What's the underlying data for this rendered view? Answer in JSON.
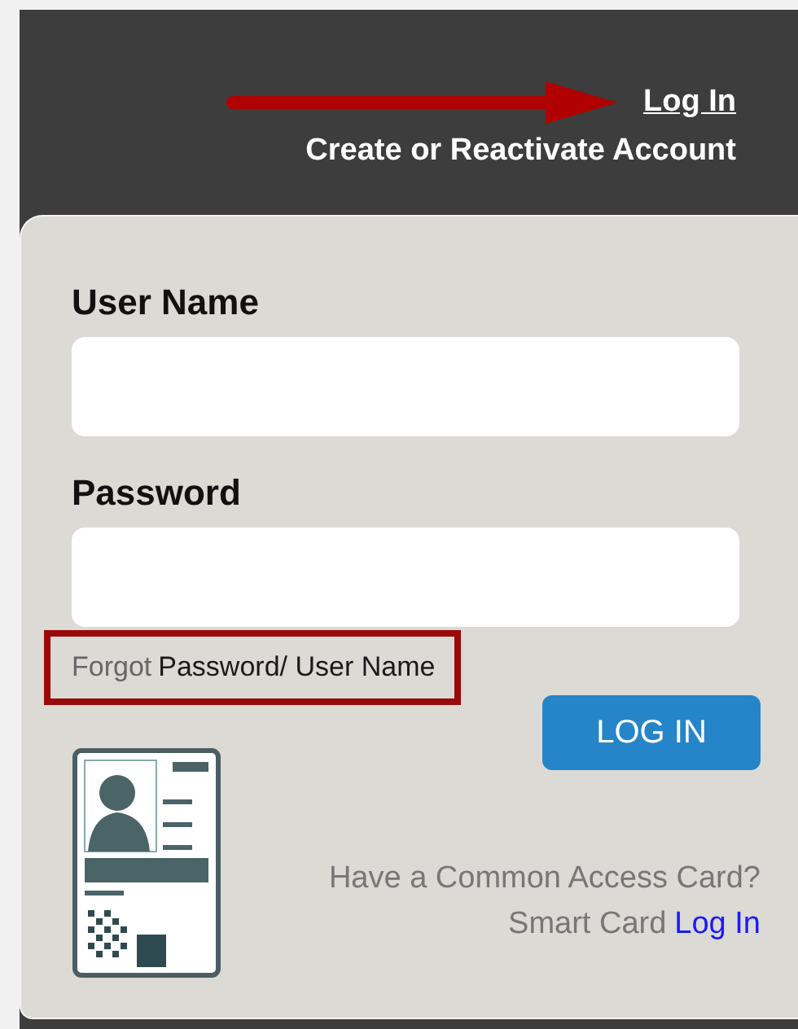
{
  "header": {
    "login_link": "Log In",
    "create_link": "Create or Reactivate Account"
  },
  "form": {
    "fields": [
      {
        "label": "User Name"
      },
      {
        "label": "Password"
      }
    ],
    "forgot": {
      "prefix": "Forgot",
      "link": "Password/ User Name"
    },
    "submit": "LOG IN"
  },
  "cac": {
    "question": "Have a Common Access Card?",
    "prompt": "Smart Card",
    "link": "Log In"
  }
}
